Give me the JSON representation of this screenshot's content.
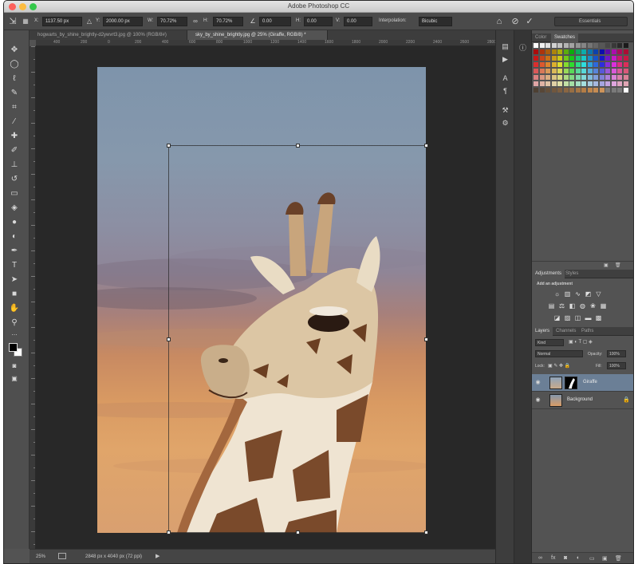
{
  "window": {
    "title": "Adobe Photoshop CC"
  },
  "options_bar": {
    "x_value": "1137.50 px",
    "y_value": "2000.00 px",
    "w_label": "W:",
    "w_value": "70.72%",
    "h_label": "H:",
    "h_value": "70.72%",
    "angle_value": "0.00",
    "hskew_label": "H:",
    "hskew_value": "0.00",
    "vskew_label": "V:",
    "vskew_value": "0.00",
    "interpolation_label": "Interpolation:",
    "interpolation_value": "Bicubic",
    "workspace_value": "Essentials"
  },
  "tabs": [
    {
      "label": "hogwarts_by_shine_brightly-d2ywvrt3.jpg @ 100% (RGB/8#)"
    },
    {
      "label": "sky_by_shine_brightly.jpg @ 25% (Giraffe, RGB/8) *"
    }
  ],
  "ruler_ticks": [
    "400",
    "200",
    "0",
    "200",
    "400",
    "600",
    "800",
    "1000",
    "1200",
    "1400",
    "1600",
    "1800",
    "2000",
    "2200",
    "2400",
    "2600",
    "2800",
    "3000",
    "3200"
  ],
  "status_bar": {
    "zoom": "25%",
    "doc_info": "2848 px x 4040 px (72 ppi)"
  },
  "color_panel": {
    "tabs": [
      "Color",
      "Swatches"
    ]
  },
  "adjustments_panel": {
    "tabs": [
      "Adjustments",
      "Styles"
    ],
    "heading": "Add an adjustment"
  },
  "layers_panel": {
    "tabs": [
      "Layers",
      "Channels",
      "Paths"
    ],
    "filter_kind": "Kind",
    "blend_mode": "Normal",
    "opacity_label": "Opacity:",
    "opacity_value": "100%",
    "lock_label": "Lock:",
    "fill_label": "Fill:",
    "fill_value": "100%",
    "layers": [
      {
        "name": "Giraffe",
        "selected": true
      },
      {
        "name": "Background",
        "selected": false
      }
    ]
  },
  "colors": {
    "ui_dark": "#535353",
    "pasteboard": "#282828",
    "selection": "#6b7f96",
    "close": "#fc605c",
    "minimize": "#fdbc40",
    "zoom": "#34c84a"
  }
}
